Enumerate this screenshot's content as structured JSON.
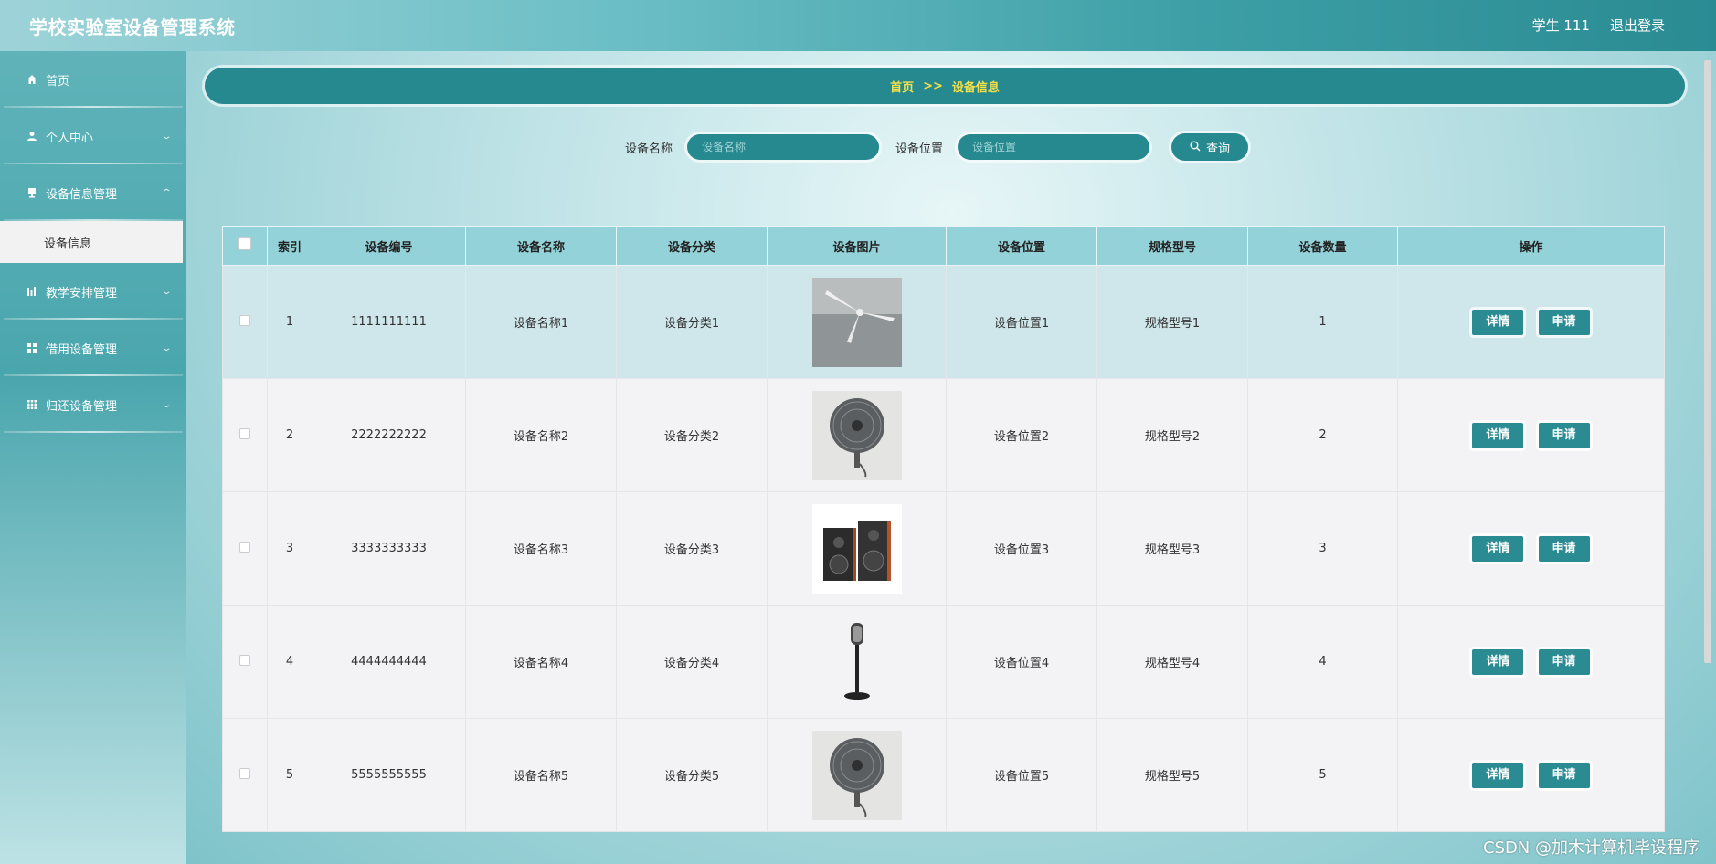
{
  "header": {
    "title": "学校实验室设备管理系统",
    "user": "学生 111",
    "logout": "退出登录"
  },
  "sidebar": {
    "items": [
      {
        "label": "首页",
        "icon": "home-icon"
      },
      {
        "label": "个人中心",
        "icon": "user-icon"
      },
      {
        "label": "设备信息管理",
        "icon": "device-icon",
        "sub": "设备信息"
      },
      {
        "label": "教学安排管理",
        "icon": "chart-icon"
      },
      {
        "label": "借用设备管理",
        "icon": "grid-icon"
      },
      {
        "label": "归还设备管理",
        "icon": "apps-icon"
      }
    ]
  },
  "breadcrumb": {
    "home": "首页",
    "sep": ">>",
    "current": "设备信息"
  },
  "search": {
    "name_label": "设备名称",
    "name_placeholder": "设备名称",
    "location_label": "设备位置",
    "location_placeholder": "设备位置",
    "query_label": "查询"
  },
  "table": {
    "headers": [
      "索引",
      "设备编号",
      "设备名称",
      "设备分类",
      "设备图片",
      "设备位置",
      "规格型号",
      "设备数量",
      "操作"
    ],
    "rows": [
      {
        "index": "1",
        "code": "1111111111",
        "name": "设备名称1",
        "category": "设备分类1",
        "image": "ceiling-fan",
        "location": "设备位置1",
        "model": "规格型号1",
        "qty": "1"
      },
      {
        "index": "2",
        "code": "2222222222",
        "name": "设备名称2",
        "category": "设备分类2",
        "image": "wall-fan",
        "location": "设备位置2",
        "model": "规格型号2",
        "qty": "2"
      },
      {
        "index": "3",
        "code": "3333333333",
        "name": "设备名称3",
        "category": "设备分类3",
        "image": "speakers",
        "location": "设备位置3",
        "model": "规格型号3",
        "qty": "3"
      },
      {
        "index": "4",
        "code": "4444444444",
        "name": "设备名称4",
        "category": "设备分类4",
        "image": "microphone",
        "location": "设备位置4",
        "model": "规格型号4",
        "qty": "4"
      },
      {
        "index": "5",
        "code": "5555555555",
        "name": "设备名称5",
        "category": "设备分类5",
        "image": "wall-fan",
        "location": "设备位置5",
        "model": "规格型号5",
        "qty": "5"
      }
    ],
    "detail_label": "详情",
    "apply_label": "申请"
  },
  "watermark": "CSDN @加木计算机毕设程序",
  "colors": {
    "primary": "#25898f",
    "header_head": "#93d2d8",
    "breadcrumb_text": "#f3e04a"
  }
}
